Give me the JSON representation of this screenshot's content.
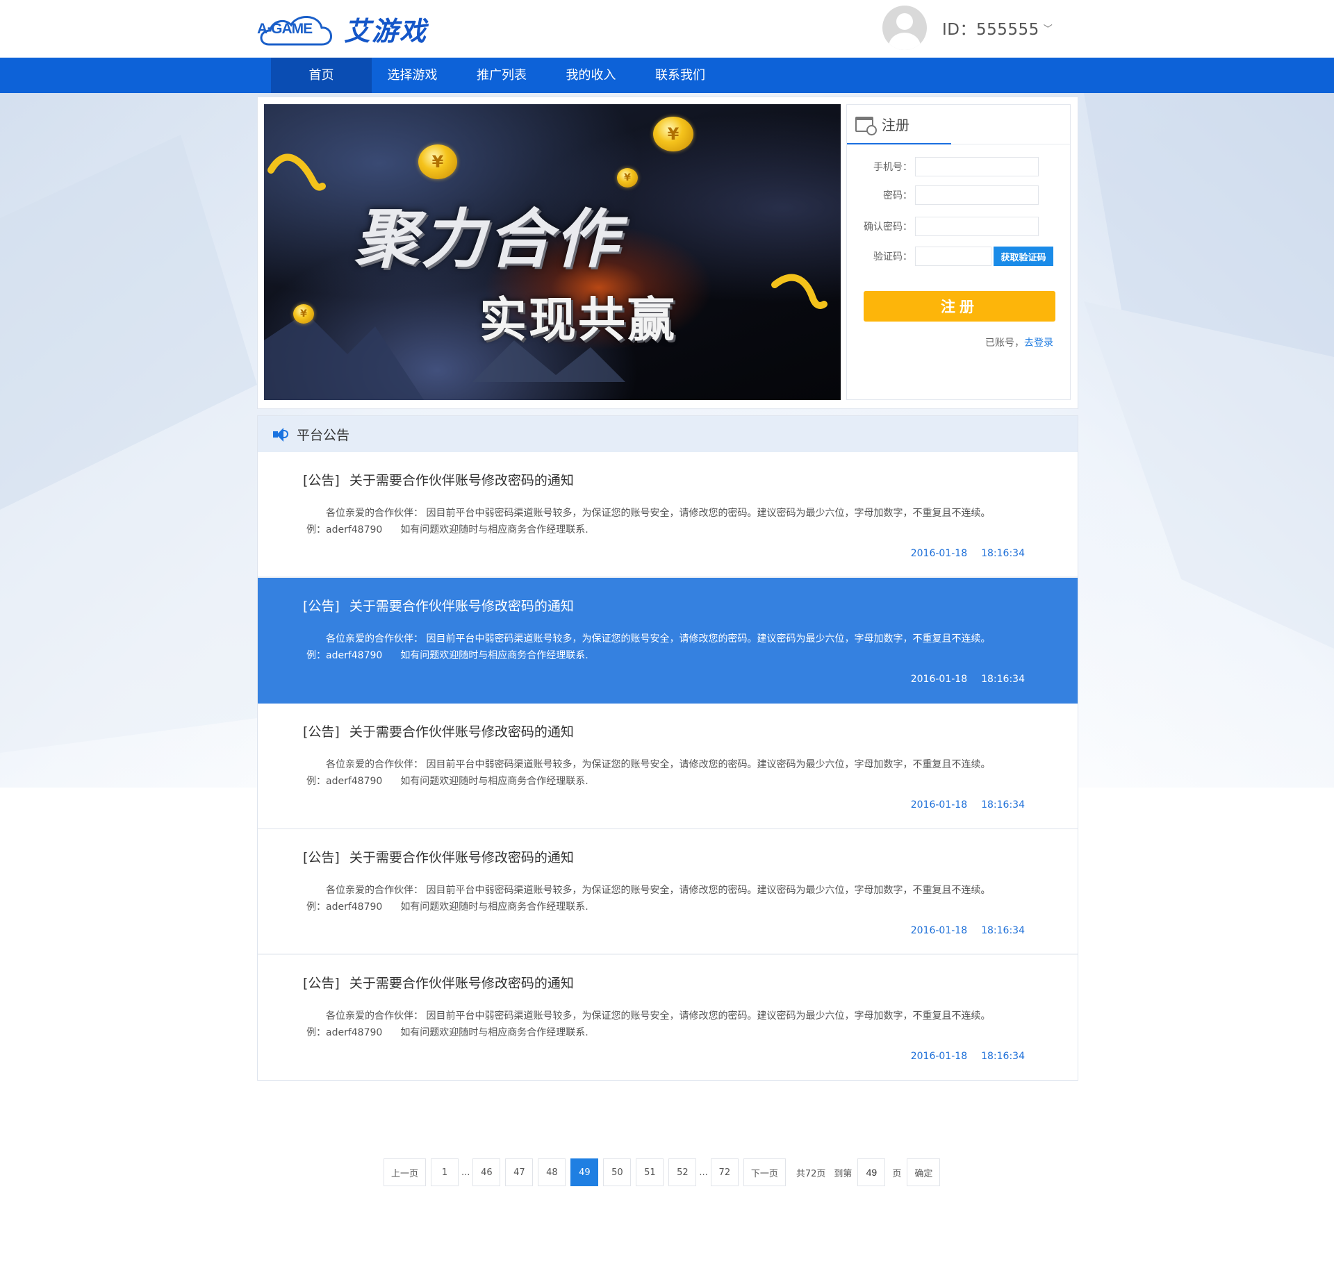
{
  "header": {
    "logo_text": "A·GAME",
    "logo_cn": "艾游戏",
    "user_id": "ID：555555",
    "caret": "﹀"
  },
  "nav": {
    "items": [
      {
        "label": "首页"
      },
      {
        "label": "选择游戏"
      },
      {
        "label": "推广列表"
      },
      {
        "label": "我的收入"
      },
      {
        "label": "联系我们"
      }
    ],
    "active_index": 0
  },
  "banner": {
    "line1": "聚力合作",
    "line2": "实现共赢",
    "coin_symbol": "¥"
  },
  "register": {
    "tab_label": "注册",
    "phone_label": "手机号：",
    "password_label": "密码：",
    "confirm_label": "确认密码：",
    "captcha_label": "验证码：",
    "get_code": "获取验证码",
    "submit": "注册",
    "has_account": "已账号，",
    "login_link": "去登录"
  },
  "notices": {
    "title": "平台公告",
    "items": [
      {
        "tag": "[公告]",
        "title": "关于需要合作伙伴账号修改密码的通知",
        "body1": "各位亲爱的合作伙伴： 因目前平台中弱密码渠道账号较多，为保证您的账号安全，请修改您的密码。建议密码为最少六位，字母加数字，不重复且不连续。",
        "body2a": "例：aderf48790",
        "body2b": "如有问题欢迎随时与相应商务合作经理联系.",
        "date": "2016-01-18",
        "time": "18:16:34"
      },
      {
        "tag": "[公告]",
        "title": "关于需要合作伙伴账号修改密码的通知",
        "body1": "各位亲爱的合作伙伴： 因目前平台中弱密码渠道账号较多，为保证您的账号安全，请修改您的密码。建议密码为最少六位，字母加数字，不重复且不连续。",
        "body2a": "例：aderf48790",
        "body2b": "如有问题欢迎随时与相应商务合作经理联系.",
        "date": "2016-01-18",
        "time": "18:16:34"
      },
      {
        "tag": "[公告]",
        "title": "关于需要合作伙伴账号修改密码的通知",
        "body1": "各位亲爱的合作伙伴： 因目前平台中弱密码渠道账号较多，为保证您的账号安全，请修改您的密码。建议密码为最少六位，字母加数字，不重复且不连续。",
        "body2a": "例：aderf48790",
        "body2b": "如有问题欢迎随时与相应商务合作经理联系.",
        "date": "2016-01-18",
        "time": "18:16:34"
      },
      {
        "tag": "[公告]",
        "title": "关于需要合作伙伴账号修改密码的通知",
        "body1": "各位亲爱的合作伙伴： 因目前平台中弱密码渠道账号较多，为保证您的账号安全，请修改您的密码。建议密码为最少六位，字母加数字，不重复且不连续。",
        "body2a": "例：aderf48790",
        "body2b": "如有问题欢迎随时与相应商务合作经理联系.",
        "date": "2016-01-18",
        "time": "18:16:34"
      },
      {
        "tag": "[公告]",
        "title": "关于需要合作伙伴账号修改密码的通知",
        "body1": "各位亲爱的合作伙伴： 因目前平台中弱密码渠道账号较多，为保证您的账号安全，请修改您的密码。建议密码为最少六位，字母加数字，不重复且不连续。",
        "body2a": "例：aderf48790",
        "body2b": "如有问题欢迎随时与相应商务合作经理联系.",
        "date": "2016-01-18",
        "time": "18:16:34"
      }
    ],
    "highlighted_index": 1
  },
  "pagination": {
    "prev": "上一页",
    "next": "下一页",
    "first": "1",
    "pages": [
      "46",
      "47",
      "48",
      "49",
      "50",
      "51",
      "52"
    ],
    "last": "72",
    "current": "49",
    "ellipsis": "...",
    "total": "共72页",
    "goto_label": "到第",
    "goto_value": "49",
    "page_suffix": "页",
    "confirm": "确定"
  },
  "colors": {
    "nav_blue": "#0d62d8",
    "highlight_blue": "#3581e0",
    "submit_yellow": "#fdb50a",
    "link_blue": "#1d7ae0"
  }
}
